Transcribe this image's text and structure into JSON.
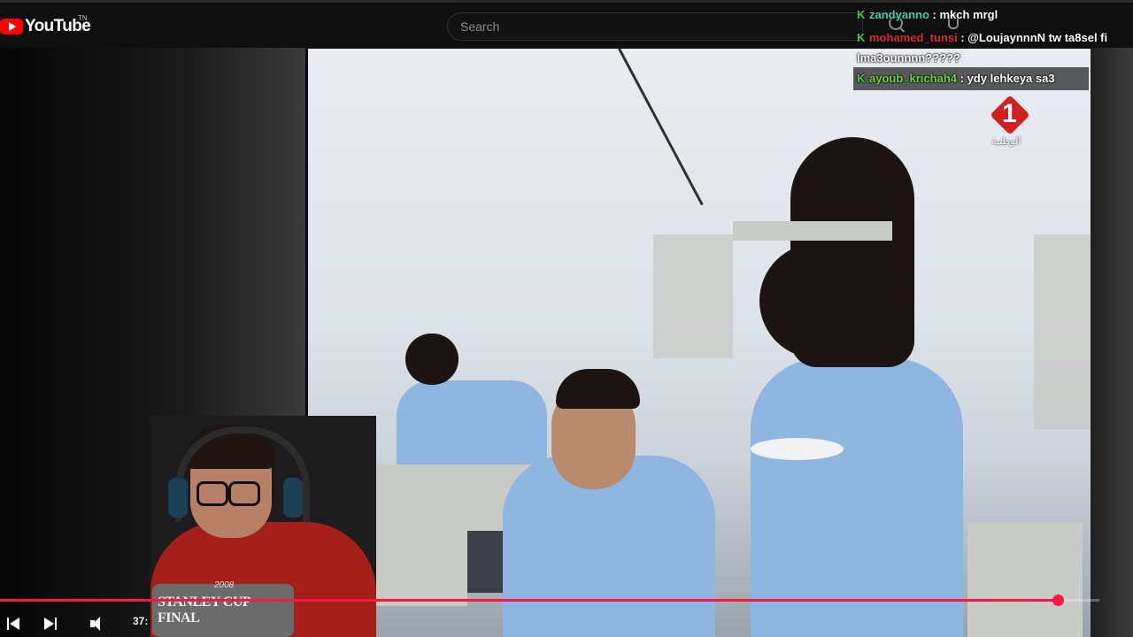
{
  "header": {
    "logo_text": "YouTube",
    "logo_sup": "TN",
    "search_placeholder": "Search"
  },
  "video": {
    "channel_logo_number": "1",
    "channel_logo_text": "الوطنية"
  },
  "chat": {
    "messages": [
      {
        "badge": "K",
        "user": "zandyanno",
        "user_color": "#3fd2b0",
        "text": ": mkch mrgl"
      },
      {
        "badge": "K",
        "user": "mohamed_tunsi",
        "user_color": "#e02828",
        "text": ": @LoujaynnnN tw ta8sel fi",
        "continuation": "lma3ounnnn?????"
      },
      {
        "badge": "K",
        "user": "ayoub_krichah4",
        "user_color": "#6fd23f",
        "text": ": ydy lehkeya sa3"
      }
    ]
  },
  "webcam": {
    "shirt_text": "STANLEY CUP FINAL",
    "shirt_year": "2008"
  },
  "player": {
    "time_visible": "37:",
    "progress": 0.962
  },
  "colors": {
    "accent": "#ff1744",
    "youtube_red": "#ff0000"
  }
}
